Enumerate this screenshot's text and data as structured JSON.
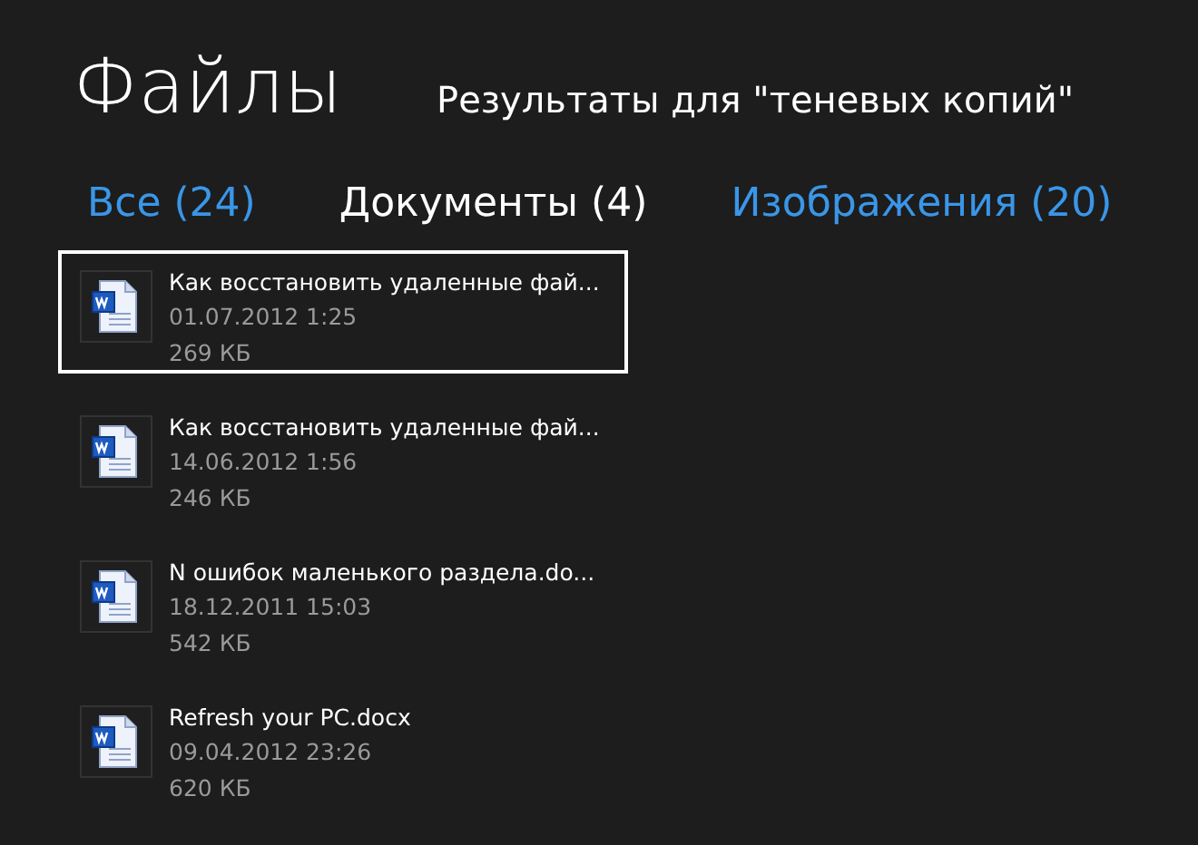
{
  "header": {
    "title": "Файлы",
    "subtitle": "Результаты для \"теневых копий\""
  },
  "tabs": [
    {
      "label": "Все (24)",
      "selected": false
    },
    {
      "label": "Документы (4)",
      "selected": true
    },
    {
      "label": "Изображения (20)",
      "selected": false
    }
  ],
  "files": [
    {
      "name": "Как восстановить удаленные фай...",
      "date": "01.07.2012 1:25",
      "size": "269 КБ",
      "selected": true
    },
    {
      "name": "Как восстановить удаленные фай...",
      "date": "14.06.2012 1:56",
      "size": "246 КБ",
      "selected": false
    },
    {
      "name": "N ошибок маленького раздела.do...",
      "date": "18.12.2011 15:03",
      "size": "542 КБ",
      "selected": false
    },
    {
      "name": "Refresh your PC.docx",
      "date": "09.04.2012 23:26",
      "size": "620 КБ",
      "selected": false
    }
  ]
}
